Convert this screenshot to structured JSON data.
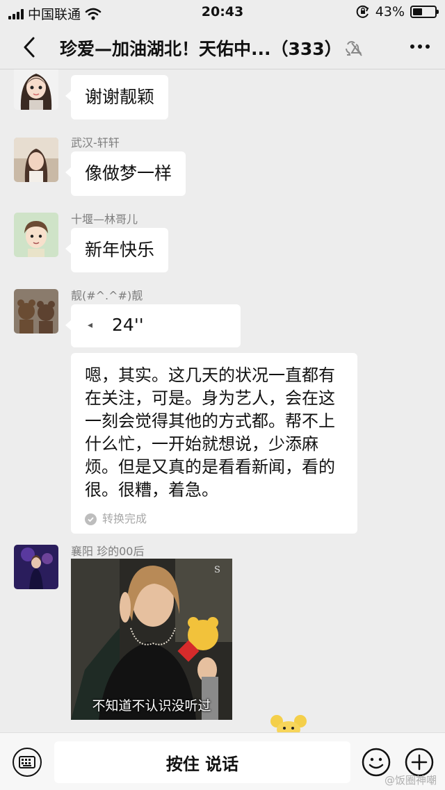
{
  "status_bar": {
    "carrier": "中国联通",
    "time": "20:43",
    "battery": "43%",
    "battery_level": 0.43,
    "icons": [
      "signal-icon",
      "wifi-icon",
      "orientation-lock-icon",
      "battery-icon"
    ]
  },
  "header": {
    "title": "珍爱—加油湖北！天佑中...（333）",
    "icons": [
      "back-icon",
      "ear-icon",
      "mute-icon",
      "more-icon"
    ]
  },
  "messages": [
    {
      "sender": "",
      "text": "谢谢靓颖"
    },
    {
      "sender": "武汉-轩轩",
      "text": "像做梦一样"
    },
    {
      "sender": "十堰—林哥儿",
      "text": "新年快乐"
    },
    {
      "sender": "靓(#^.^#)靓",
      "voice_duration": "24''",
      "transcript": "嗯，其实。这几天的状况一直都有在关注，可是。身为艺人，会在这一刻会觉得其他的方式都。帮不上什么忙，一开始就想说，少添麻烦。但是又真的是看看新闻，看的很。很糟，着急。",
      "transcript_status": "转换完成"
    },
    {
      "sender": "襄阳 珍的00后",
      "image_caption": "不知道不认识没听过"
    }
  ],
  "input_bar": {
    "hold_to_talk": "按住 说话",
    "icons": [
      "keyboard-icon",
      "emoji-icon",
      "plus-icon"
    ]
  },
  "watermark": "@饭圈神嘲"
}
